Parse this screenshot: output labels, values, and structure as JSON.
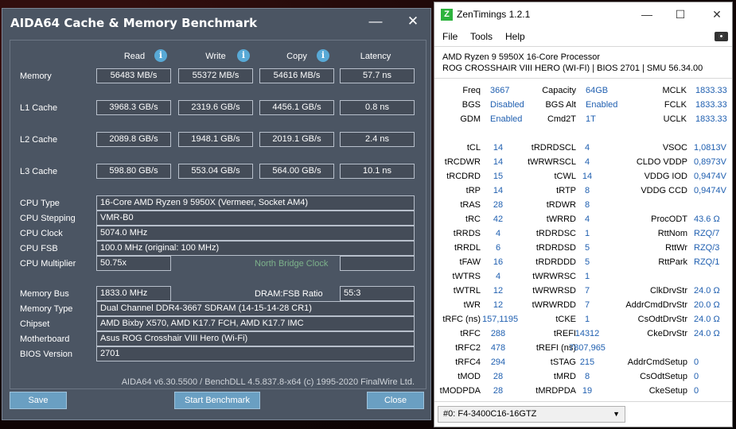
{
  "aida": {
    "title": "AIDA64 Cache & Memory Benchmark",
    "headers": {
      "read": "Read",
      "write": "Write",
      "copy": "Copy",
      "latency": "Latency"
    },
    "rows": [
      {
        "label": "Memory",
        "read": "56483 MB/s",
        "write": "55372 MB/s",
        "copy": "54616 MB/s",
        "latency": "57.7 ns"
      },
      {
        "label": "L1 Cache",
        "read": "3968.3 GB/s",
        "write": "2319.6 GB/s",
        "copy": "4456.1 GB/s",
        "latency": "0.8 ns"
      },
      {
        "label": "L2 Cache",
        "read": "2089.8 GB/s",
        "write": "1948.1 GB/s",
        "copy": "2019.1 GB/s",
        "latency": "2.4 ns"
      },
      {
        "label": "L3 Cache",
        "read": "598.80 GB/s",
        "write": "553.04 GB/s",
        "copy": "564.00 GB/s",
        "latency": "10.1 ns"
      }
    ],
    "info": {
      "cpu_type_label": "CPU Type",
      "cpu_type": "16-Core AMD Ryzen 9 5950X  (Vermeer, Socket AM4)",
      "cpu_stepping_label": "CPU Stepping",
      "cpu_stepping": "VMR-B0",
      "cpu_clock_label": "CPU Clock",
      "cpu_clock": "5074.0 MHz",
      "cpu_fsb_label": "CPU FSB",
      "cpu_fsb": "100.0 MHz  (original: 100 MHz)",
      "cpu_mult_label": "CPU Multiplier",
      "cpu_mult": "50.75x",
      "north_bridge_label": "North Bridge Clock",
      "mem_bus_label": "Memory Bus",
      "mem_bus": "1833.0 MHz",
      "dram_fsb_label": "DRAM:FSB Ratio",
      "dram_fsb": "55:3",
      "mem_type_label": "Memory Type",
      "mem_type": "Dual Channel DDR4-3667 SDRAM  (14-15-14-28 CR1)",
      "chipset_label": "Chipset",
      "chipset": "AMD Bixby X570, AMD K17.7 FCH, AMD K17.7 IMC",
      "mobo_label": "Motherboard",
      "mobo": "Asus ROG Crosshair VIII Hero (Wi-Fi)",
      "bios_label": "BIOS Version",
      "bios": "2701"
    },
    "footer": "AIDA64 v6.30.5500 / BenchDLL 4.5.837.8-x64  (c) 1995-2020 FinalWire Ltd.",
    "buttons": {
      "save": "Save",
      "start": "Start Benchmark",
      "close": "Close"
    }
  },
  "zen": {
    "title": "ZenTimings 1.2.1",
    "menu": {
      "file": "File",
      "tools": "Tools",
      "help": "Help"
    },
    "cpu_line1": "AMD Ryzen 9 5950X 16-Core Processor",
    "cpu_line2": "ROG CROSSHAIR VIII HERO (WI-FI) | BIOS 2701 | SMU 56.34.00",
    "col1": [
      [
        "Freq",
        "3667"
      ],
      [
        "BGS",
        "Disabled"
      ],
      [
        "GDM",
        "Enabled"
      ]
    ],
    "col2": [
      [
        "Capacity",
        "64GB"
      ],
      [
        "BGS Alt",
        "Enabled"
      ],
      [
        "Cmd2T",
        "1T"
      ]
    ],
    "col3": [
      [
        "MCLK",
        "1833.33"
      ],
      [
        "FCLK",
        "1833.33"
      ],
      [
        "UCLK",
        "1833.33"
      ]
    ],
    "t1": [
      [
        "tCL",
        "14"
      ],
      [
        "tRCDWR",
        "14"
      ],
      [
        "tRCDRD",
        "15"
      ],
      [
        "tRP",
        "14"
      ],
      [
        "tRAS",
        "28"
      ],
      [
        "tRC",
        "42"
      ],
      [
        "tRRDS",
        "4"
      ],
      [
        "tRRDL",
        "6"
      ],
      [
        "tFAW",
        "16"
      ],
      [
        "tWTRS",
        "4"
      ],
      [
        "tWTRL",
        "12"
      ],
      [
        "tWR",
        "12"
      ],
      [
        "tRFC (ns)",
        "157,1195"
      ],
      [
        "tRFC",
        "288"
      ],
      [
        "tRFC2",
        "478"
      ],
      [
        "tRFC4",
        "294"
      ],
      [
        "tMOD",
        "28"
      ],
      [
        "tMODPDA",
        "28"
      ]
    ],
    "t2": [
      [
        "tRDRDSCL",
        "4"
      ],
      [
        "tWRWRSCL",
        "4"
      ],
      [
        "tCWL",
        "14"
      ],
      [
        "tRTP",
        "8"
      ],
      [
        "tRDWR",
        "8"
      ],
      [
        "tWRRD",
        "4"
      ],
      [
        "tRDRDSC",
        "1"
      ],
      [
        "tRDRDSD",
        "5"
      ],
      [
        "tRDRDDD",
        "5"
      ],
      [
        "tWRWRSC",
        "1"
      ],
      [
        "tWRWRSD",
        "7"
      ],
      [
        "tWRWRDD",
        "7"
      ],
      [
        "tCKE",
        "1"
      ],
      [
        "tREFI",
        "14312"
      ],
      [
        "tREFI (ns)",
        "7807,965"
      ],
      [
        "tSTAG",
        "215"
      ],
      [
        "tMRD",
        "8"
      ],
      [
        "tMRDPDA",
        "19"
      ]
    ],
    "t3": [
      [
        "VSOC",
        "1,0813V"
      ],
      [
        "CLDO VDDP",
        "0,8973V"
      ],
      [
        "VDDG IOD",
        "0,9474V"
      ],
      [
        "VDDG CCD",
        "0,9474V"
      ],
      [
        "",
        ""
      ],
      [
        "ProcODT",
        "43.6 Ω"
      ],
      [
        "RttNom",
        "RZQ/7"
      ],
      [
        "RttWr",
        "RZQ/3"
      ],
      [
        "RttPark",
        "RZQ/1"
      ],
      [
        "",
        ""
      ],
      [
        "ClkDrvStr",
        "24.0 Ω"
      ],
      [
        "AddrCmdDrvStr",
        "20.0 Ω"
      ],
      [
        "CsOdtDrvStr",
        "24.0 Ω"
      ],
      [
        "CkeDrvStr",
        "24.0 Ω"
      ],
      [
        "",
        ""
      ],
      [
        "AddrCmdSetup",
        "0"
      ],
      [
        "CsOdtSetup",
        "0"
      ],
      [
        "CkeSetup",
        "0"
      ]
    ],
    "module": "#0: F4-3400C16-16GTZ"
  }
}
